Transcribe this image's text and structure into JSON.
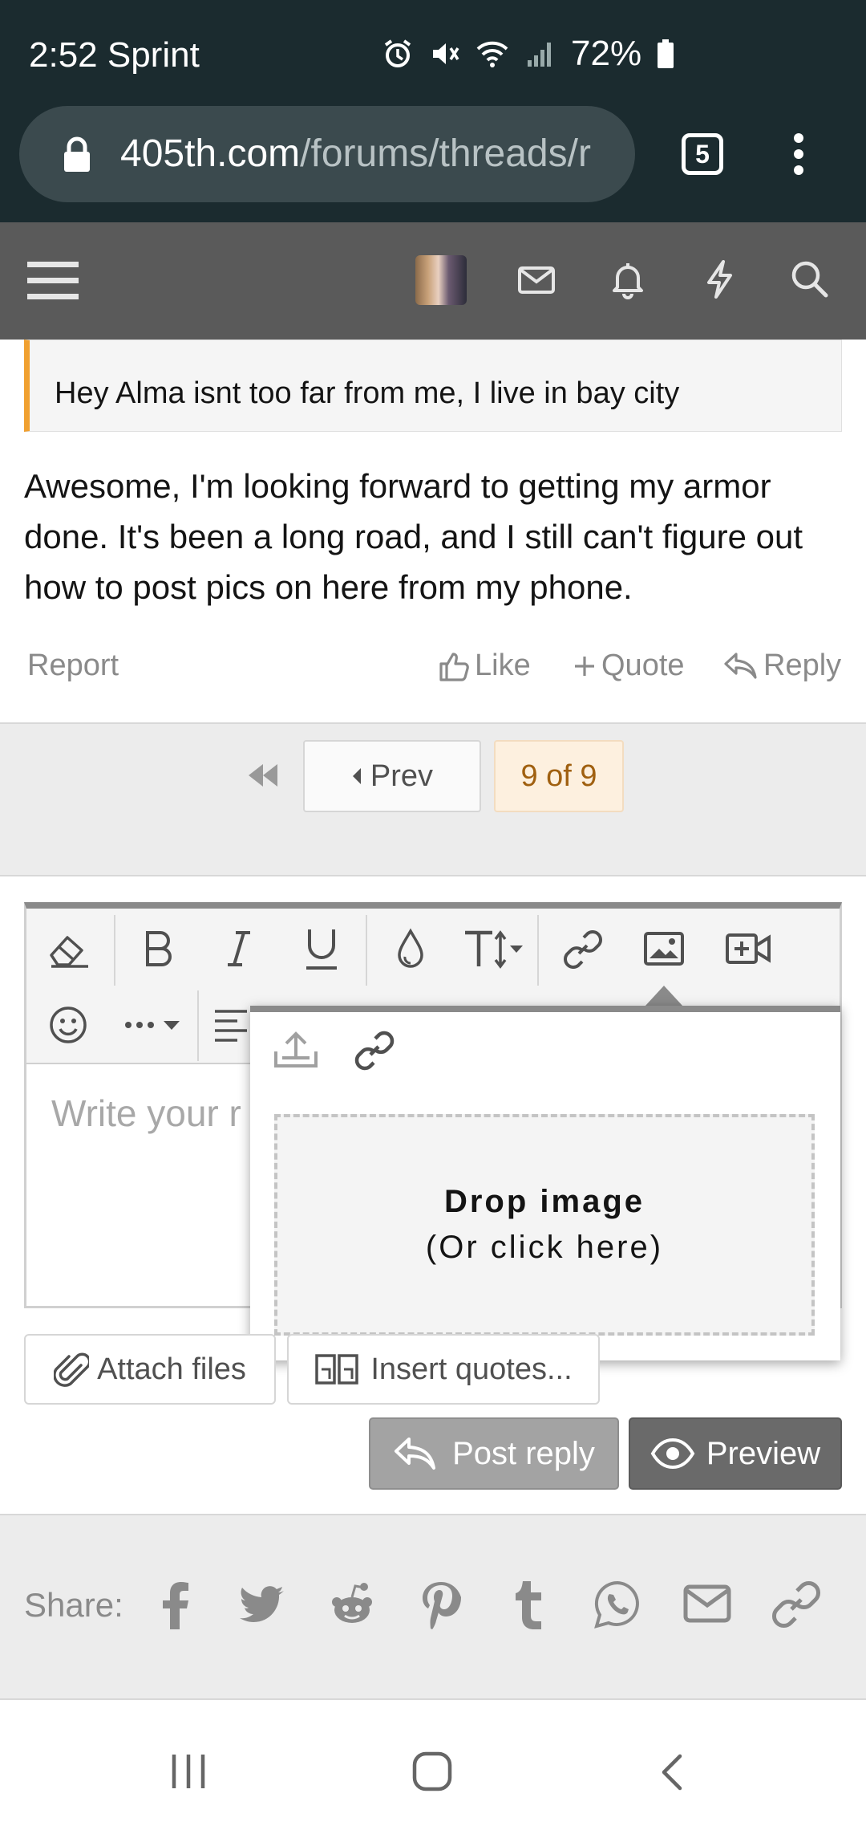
{
  "status": {
    "time": "2:52 Sprint",
    "battery": "72%"
  },
  "browser": {
    "url_host": "405th.com",
    "url_path": "/forums/threads/r",
    "tab_count": "5"
  },
  "quote": {
    "text": "Hey Alma isnt too far from me, I live in bay city"
  },
  "post": {
    "body": "Awesome, I'm looking forward to getting my armor done. It's been a long road, and I still can't figure out how to post pics on here from my phone.",
    "report": "Report",
    "like": "Like",
    "quote": "Quote",
    "reply": "Reply"
  },
  "pager": {
    "prev": "Prev",
    "current": "9 of 9"
  },
  "editor": {
    "placeholder": "Write your r",
    "popup": {
      "title": "Drop image",
      "subtitle": "(Or click here)"
    },
    "attach_files": "Attach files",
    "insert_quotes": "Insert quotes...",
    "post_reply": "Post reply",
    "preview": "Preview"
  },
  "share": {
    "label": "Share:"
  },
  "colors": {
    "accent": "#f0a030",
    "status_bar": "#1b2b2f",
    "nav_bar": "#5a5a5a"
  }
}
